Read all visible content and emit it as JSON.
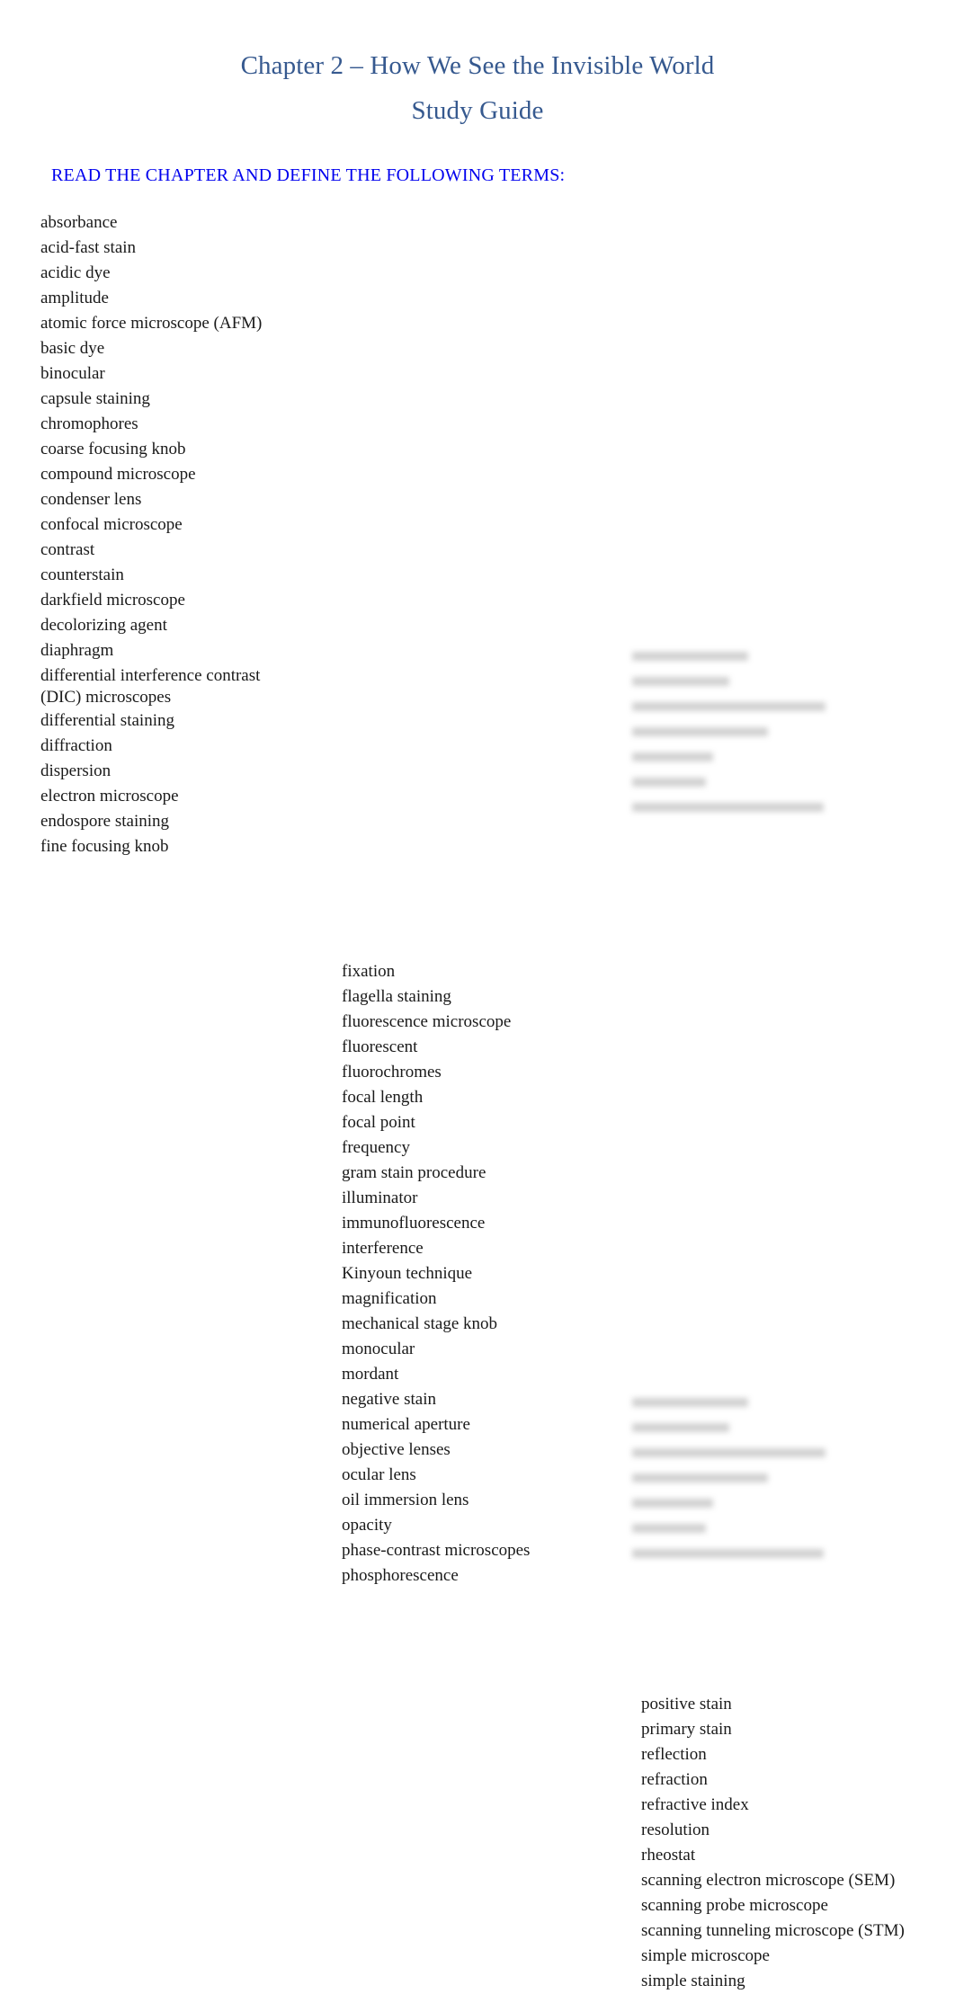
{
  "document": {
    "title_line_1": "Chapter 2 – How We See the Invisible World",
    "title_line_2": "Study Guide",
    "title_color": "#36598f",
    "instruction": "READ THE CHAPTER AND DEFINE THE FOLLOWING TERMS:",
    "instruction_color": "#0000ee",
    "body_color": "#1a1a1a",
    "page_background": "#ffffff"
  },
  "columns": [
    {
      "id": "column-1",
      "terms": [
        "absorbance",
        "acid-fast stain",
        "acidic dye",
        "amplitude",
        "atomic force microscope (AFM)",
        "basic dye",
        "binocular",
        "capsule staining",
        "chromophores",
        "coarse focusing knob",
        "compound microscope",
        "condenser lens",
        "confocal microscope",
        "contrast",
        "counterstain",
        "darkfield microscope",
        "decolorizing agent",
        "diaphragm",
        "differential interference contrast",
        "(DIC) microscopes",
        "differential staining",
        "diffraction",
        "dispersion",
        "electron microscope",
        "endospore staining",
        "fine focusing knob"
      ]
    },
    {
      "id": "column-2",
      "terms": [
        "fixation",
        "flagella staining",
        "fluorescence microscope",
        "fluorescent",
        "fluorochromes",
        "focal length",
        "focal point",
        "frequency",
        "gram stain procedure",
        "illuminator",
        "immunofluorescence",
        "interference",
        "Kinyoun technique",
        "magnification",
        "mechanical stage knob",
        "monocular",
        "mordant",
        "negative stain",
        "numerical aperture",
        "objective lenses",
        "ocular lens",
        "oil immersion lens",
        "opacity",
        "phase-contrast microscopes",
        "phosphorescence"
      ]
    },
    {
      "id": "column-3",
      "terms": [
        "positive stain",
        "primary stain",
        "reflection",
        "refraction",
        "refractive index",
        "resolution",
        "rheostat",
        "scanning electron microscope (SEM)",
        "scanning probe microscope",
        "scanning tunneling microscope (STM)",
        "simple microscope",
        "simple staining"
      ]
    }
  ],
  "redacted_blocks": [
    {
      "id": "redacted-block-1",
      "note": "illegible blurred text",
      "line_widths": [
        "w-60",
        "w-50",
        "w-100",
        "w-70",
        "w-42",
        "w-38",
        "w-99"
      ]
    },
    {
      "id": "redacted-block-2",
      "note": "illegible blurred text",
      "line_widths": [
        "w-60",
        "w-50",
        "w-100",
        "w-70",
        "w-42",
        "w-38",
        "w-99"
      ]
    }
  ]
}
